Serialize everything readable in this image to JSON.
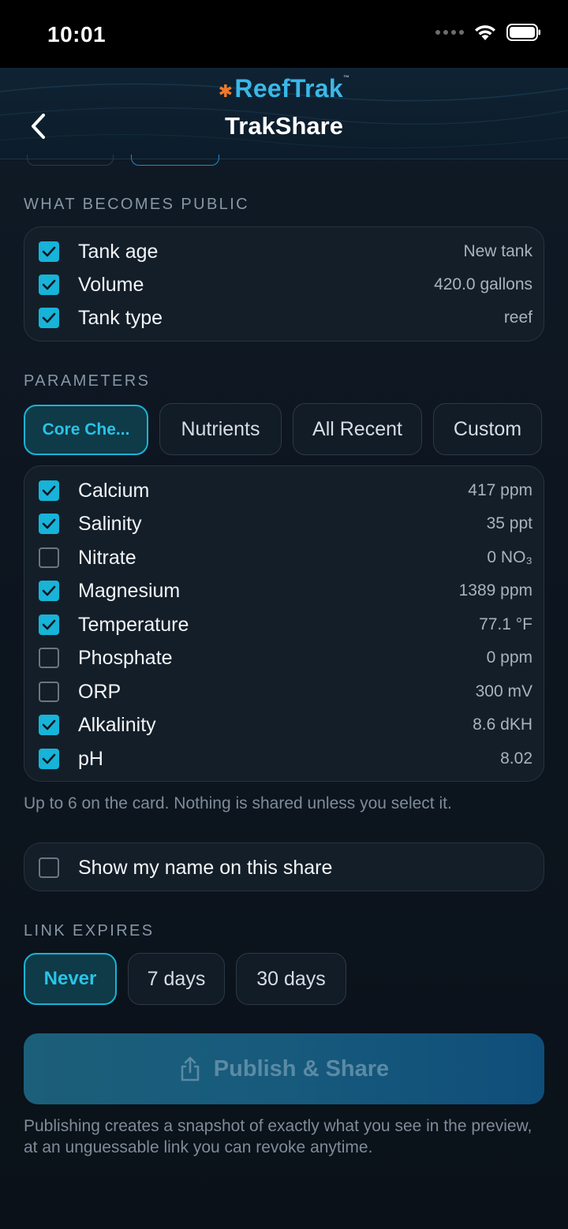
{
  "status_bar": {
    "time": "10:01"
  },
  "header": {
    "brand": "ReefTrak",
    "trademark": "™",
    "title": "TrakShare"
  },
  "public_section": {
    "label": "WHAT BECOMES PUBLIC",
    "items": [
      {
        "label": "Tank age",
        "value": "New tank",
        "checked": true
      },
      {
        "label": "Volume",
        "value": "420.0 gallons",
        "checked": true
      },
      {
        "label": "Tank type",
        "value": "reef",
        "checked": true
      }
    ]
  },
  "parameters_section": {
    "label": "PARAMETERS",
    "presets": [
      {
        "label": "Core Che...",
        "active": true
      },
      {
        "label": "Nutrients",
        "active": false
      },
      {
        "label": "All Recent",
        "active": false
      },
      {
        "label": "Custom",
        "active": false
      }
    ],
    "items": [
      {
        "label": "Calcium",
        "value": "417 ppm",
        "checked": true
      },
      {
        "label": "Salinity",
        "value": "35 ppt",
        "checked": true
      },
      {
        "label": "Nitrate",
        "value": "0 NO₃",
        "checked": false
      },
      {
        "label": "Magnesium",
        "value": "1389 ppm",
        "checked": true
      },
      {
        "label": "Temperature",
        "value": "77.1 °F",
        "checked": true
      },
      {
        "label": "Phosphate",
        "value": "0 ppm",
        "checked": false
      },
      {
        "label": "ORP",
        "value": "300 mV",
        "checked": false
      },
      {
        "label": "Alkalinity",
        "value": "8.6 dKH",
        "checked": true
      },
      {
        "label": "pH",
        "value": "8.02",
        "checked": true
      }
    ],
    "hint": "Up to 6 on the card. Nothing is shared unless you select it."
  },
  "show_name": {
    "label": "Show my name on this share",
    "checked": false
  },
  "expiry_section": {
    "label": "LINK EXPIRES",
    "options": [
      {
        "label": "Never",
        "active": true
      },
      {
        "label": "7 days",
        "active": false
      },
      {
        "label": "30 days",
        "active": false
      }
    ]
  },
  "publish": {
    "label": "Publish & Share",
    "footnote": "Publishing creates a snapshot of exactly what you see in the preview, at an unguessable link you can revoke anytime."
  }
}
